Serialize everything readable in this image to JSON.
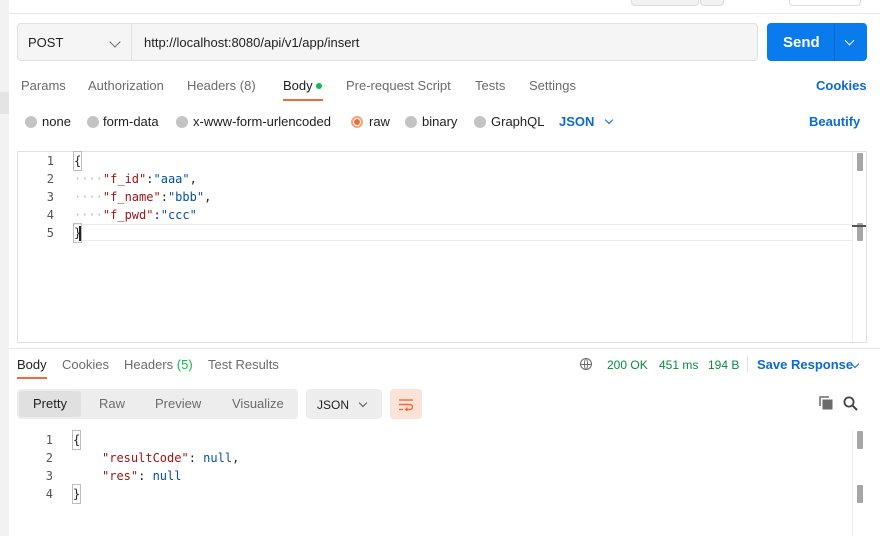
{
  "request": {
    "method": "POST",
    "url": "http://localhost:8080/api/v1/app/insert",
    "send_label": "Send"
  },
  "request_tabs": {
    "params": "Params",
    "authorization": "Authorization",
    "headers": "Headers",
    "headers_count": "(8)",
    "body": "Body",
    "pre_request": "Pre-request Script",
    "tests": "Tests",
    "settings": "Settings",
    "cookies": "Cookies"
  },
  "body_types": {
    "none": "none",
    "form_data": "form-data",
    "urlencoded": "x-www-form-urlencoded",
    "raw": "raw",
    "binary": "binary",
    "graphql": "GraphQL",
    "selected_format": "JSON",
    "beautify": "Beautify"
  },
  "request_body": {
    "line_numbers": [
      "1",
      "2",
      "3",
      "4",
      "5"
    ],
    "open_brace": "{",
    "close_brace": "}",
    "indent": "····",
    "fields": [
      {
        "key": "\"f_id\"",
        "sep": ":",
        "value": "\"aaa\"",
        "trail": ","
      },
      {
        "key": "\"f_name\"",
        "sep": ":",
        "value": "\"bbb\"",
        "trail": ","
      },
      {
        "key": "\"f_pwd\"",
        "sep": ":",
        "value": "\"ccc\"",
        "trail": ""
      }
    ]
  },
  "response_tabs": {
    "body": "Body",
    "cookies": "Cookies",
    "headers": "Headers",
    "headers_count": "(5)",
    "test_results": "Test Results"
  },
  "response_status": {
    "status": "200 OK",
    "time": "451 ms",
    "size": "194 B",
    "save_response": "Save Response"
  },
  "response_view": {
    "pretty": "Pretty",
    "raw": "Raw",
    "preview": "Preview",
    "visualize": "Visualize",
    "format": "JSON"
  },
  "response_body": {
    "line_numbers": [
      "1",
      "2",
      "3",
      "4"
    ],
    "open_brace": "{",
    "close_brace": "}",
    "fields": [
      {
        "key": "\"resultCode\"",
        "sep": ": ",
        "value": "null",
        "trail": ","
      },
      {
        "key": "\"res\"",
        "sep": ": ",
        "value": "null",
        "trail": ""
      }
    ]
  },
  "colors": {
    "accent_orange": "#f26b3a",
    "link_blue": "#0b6ad4",
    "send_blue": "#097bed",
    "status_green": "#0a8a3f"
  }
}
